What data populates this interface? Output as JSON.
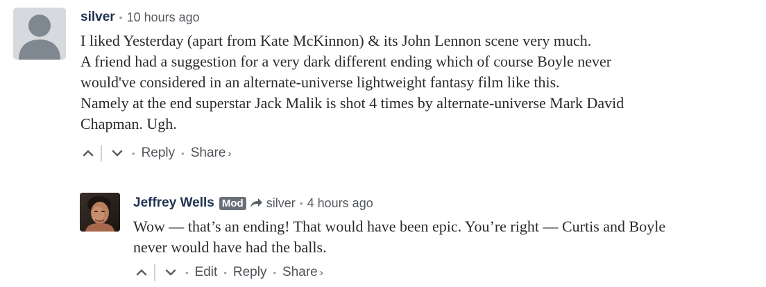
{
  "comments": [
    {
      "author": "silver",
      "timestamp": "10 hours ago",
      "body": [
        "I liked Yesterday (apart from Kate McKinnon) & its John Lennon scene very much.",
        "A friend had a suggestion for a very dark different ending which of course Boyle never",
        "would've considered in an alternate-universe lightweight fantasy film like this.",
        "Namely at the end superstar Jack Malik is shot 4 times by alternate-universe Mark David",
        "Chapman. Ugh."
      ],
      "actions": {
        "reply": "Reply",
        "share": "Share",
        "share_chevron": "›"
      }
    },
    {
      "author": "Jeffrey Wells",
      "badge": "Mod",
      "in_reply_to": "silver",
      "timestamp": "4 hours ago",
      "body": [
        "Wow — that’s an ending! That would have been epic. You’re right — Curtis and Boyle",
        "never would have had the balls."
      ],
      "actions": {
        "edit": "Edit",
        "reply": "Reply",
        "share": "Share",
        "share_chevron": "›"
      }
    }
  ],
  "separator": "•",
  "colors": {
    "author": "#1f3250",
    "meta": "#55595e",
    "badge_bg": "#697079",
    "avatar_placeholder": "#d6d9dd",
    "avatar_silhouette": "#7f8790"
  },
  "icons": {
    "upvote": "chevron-up-icon",
    "downvote": "chevron-down-icon",
    "reply_arrow": "reply-arrow-icon"
  }
}
